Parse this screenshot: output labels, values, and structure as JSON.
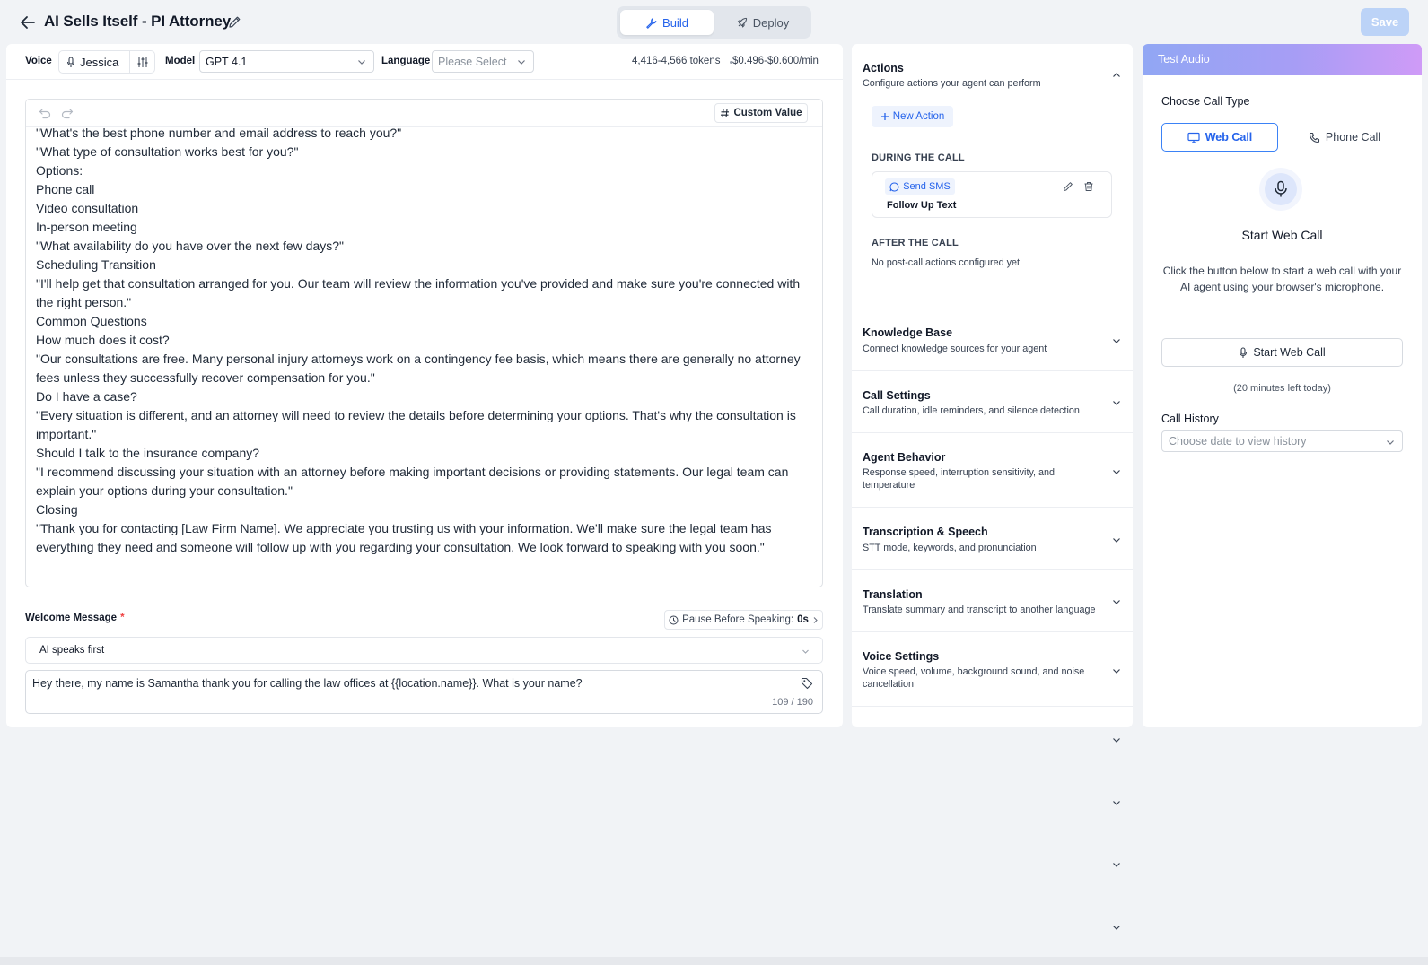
{
  "header": {
    "title": "AI Sells Itself - PI Attorney",
    "modes": {
      "build": "Build",
      "deploy": "Deploy",
      "active": "build"
    },
    "save_label": "Save"
  },
  "settings_bar": {
    "voice_label": "Voice",
    "voice_value": "Jessica",
    "model_label": "Model",
    "model_value": "GPT 4.1",
    "language_label": "Language",
    "language_placeholder": "Please Select",
    "tokens": "4,416-4,566 tokens",
    "cost": "$0.496-$0.600/min"
  },
  "prompt": {
    "custom_value_label": "Custom Value",
    "lines": [
      "\"What's the best phone number and email address to reach you?\"",
      "\"What type of consultation works best for you?\"",
      "Options:",
      "Phone call",
      "Video consultation",
      "In-person meeting",
      "\"What availability do you have over the next few days?\"",
      "Scheduling Transition",
      "\"I'll help get that consultation arranged for you. Our team will review the information you've provided and make sure you're connected with the right person.\"",
      "Common Questions",
      "How much does it cost?",
      "\"Our consultations are free. Many personal injury attorneys work on a contingency fee basis, which means there are generally no attorney fees unless they successfully recover compensation for you.\"",
      "Do I have a case?",
      "\"Every situation is different, and an attorney will need to review the details before determining your options. That's why the consultation is important.\"",
      "Should I talk to the insurance company?",
      "\"I recommend discussing your situation with an attorney before making important decisions or providing statements. Our legal team can explain your options during your consultation.\"",
      "Closing",
      "\"Thank you for contacting [Law Firm Name]. We appreciate you trusting us with your information. We'll make sure the legal team has everything they need and someone will follow up with you regarding your consultation. We look forward to speaking with you soon.\""
    ]
  },
  "welcome": {
    "label": "Welcome Message",
    "required_mark": "*",
    "pause_label": "Pause Before Speaking:",
    "pause_value": "0s",
    "mode_value": "AI speaks first",
    "message": "Hey there, my name is Samantha thank you for calling the law offices at {{location.name}}. What is your name?",
    "char_count": "109 / 190"
  },
  "config": {
    "actions": {
      "title": "Actions",
      "subtitle": "Configure actions your agent can perform",
      "new_action_label": "New Action",
      "during_label": "DURING THE CALL",
      "during_items": [
        {
          "type": "Send SMS",
          "name": "Follow Up Text"
        }
      ],
      "after_label": "AFTER THE CALL",
      "after_empty": "No post-call actions configured yet"
    },
    "sections": [
      {
        "title": "Knowledge Base",
        "subtitle": "Connect knowledge sources for your agent"
      },
      {
        "title": "Call Settings",
        "subtitle": "Call duration, idle reminders, and silence detection"
      },
      {
        "title": "Agent Behavior",
        "subtitle": "Response speed, interruption sensitivity, and temperature"
      },
      {
        "title": "Transcription & Speech",
        "subtitle": "STT mode, keywords, and pronunciation"
      },
      {
        "title": "Translation",
        "subtitle": "Translate summary and transcript to another language"
      },
      {
        "title": "Voice Settings",
        "subtitle": "Voice speed, volume, background sound, and noise cancellation"
      }
    ]
  },
  "test_audio": {
    "header": "Test Audio",
    "call_type_label": "Choose Call Type",
    "web_call_label": "Web Call",
    "phone_call_label": "Phone Call",
    "start_title": "Start Web Call",
    "start_description": "Click the button below to start a web call with your AI agent using your browser's microphone.",
    "start_button_label": "Start Web Call",
    "minutes_left": "(20 minutes left today)",
    "history_label": "Call History",
    "history_placeholder": "Choose date to view history"
  },
  "colors": {
    "accent": "#2563eb",
    "save_disabled": "#bcd3f7",
    "required": "#ef4444",
    "header_gradient": [
      "#91a7f4",
      "#cf9bf7"
    ]
  }
}
